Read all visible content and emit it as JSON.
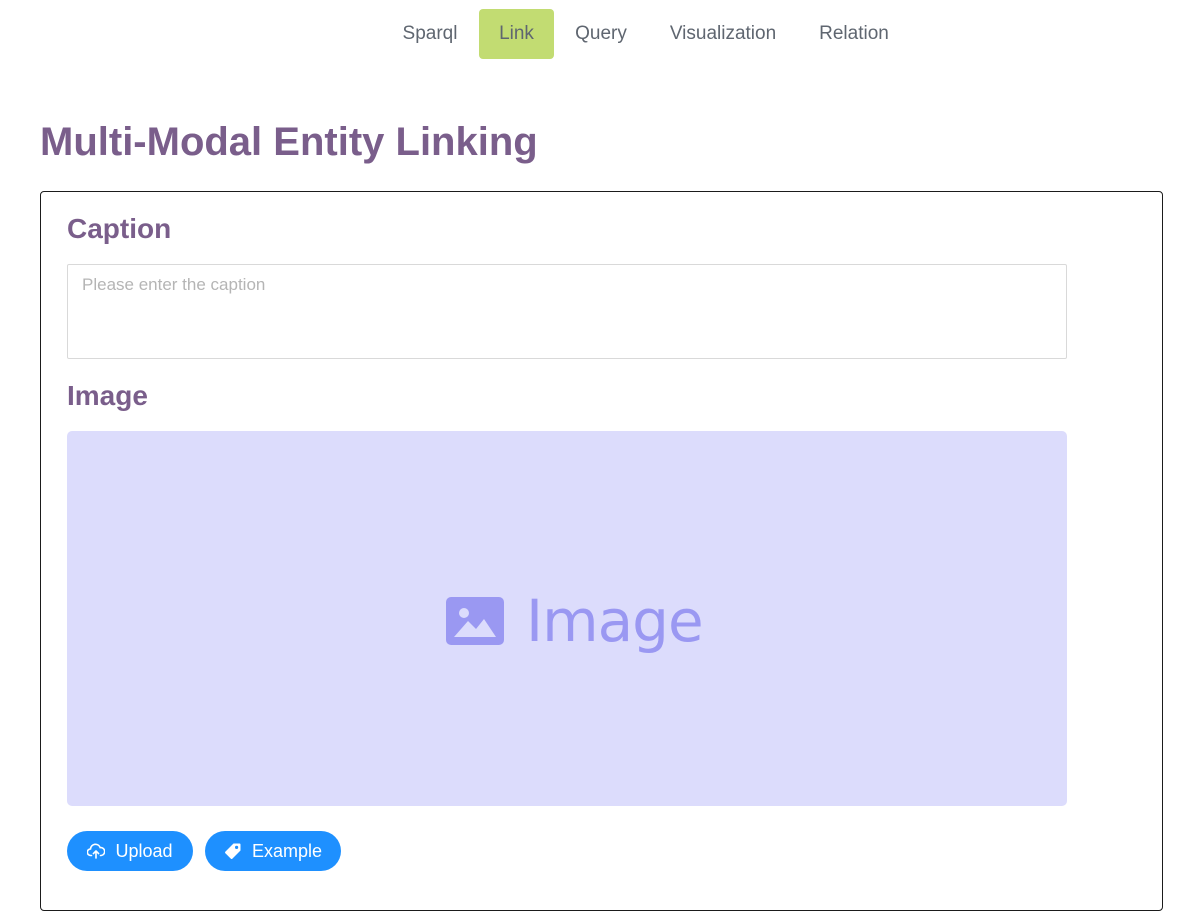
{
  "nav": {
    "items": [
      {
        "label": "Sparql",
        "active": false
      },
      {
        "label": "Link",
        "active": true
      },
      {
        "label": "Query",
        "active": false
      },
      {
        "label": "Visualization",
        "active": false
      },
      {
        "label": "Relation",
        "active": false
      }
    ]
  },
  "page": {
    "title": "Multi-Modal Entity Linking"
  },
  "caption": {
    "heading": "Caption",
    "placeholder": "Please enter the caption",
    "value": ""
  },
  "image": {
    "heading": "Image",
    "placeholder_label": "Image",
    "placeholder_icon": "image-icon"
  },
  "actions": {
    "upload_label": "Upload",
    "upload_icon": "cloud-upload-icon",
    "example_label": "Example",
    "example_icon": "tag-icon"
  },
  "colors": {
    "accent_nav_active": "#c2dc72",
    "heading": "#7a5e8b",
    "image_area_bg": "#dcdcfc",
    "image_placeholder": "#9a98f2",
    "button_primary": "#1e90ff"
  }
}
